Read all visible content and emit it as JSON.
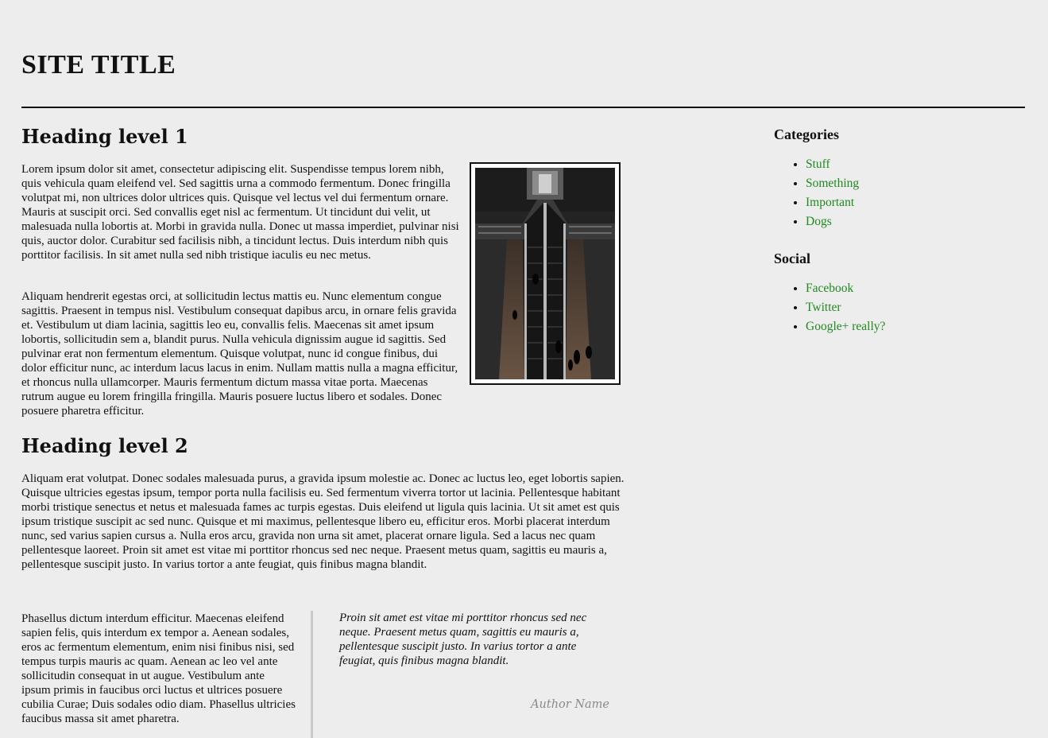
{
  "header": {
    "site_title": "SITE TITLE"
  },
  "main": {
    "heading1": "Heading level 1",
    "paragraph1": "Lorem ipsum dolor sit amet, consectetur adipiscing elit. Suspendisse tempus lorem nibh, quis vehicula quam eleifend vel. Sed sagittis urna a commodo fermentum. Donec fringilla volutpat mi, non ultrices dolor ultrices quis. Quisque vel lectus vel dui fermentum ornare. Mauris at suscipit orci. Sed convallis eget nisl ac fermentum. Ut tincidunt dui velit, ut malesuada nulla lobortis at. Morbi in gravida nulla. Donec ut massa imperdiet, pulvinar nisi quis, auctor dolor. Curabitur sed facilisis nibh, a tincidunt lectus. Duis interdum nibh quis porttitor facilisis. In sit amet nulla sed nibh tristique iaculis eu nec metus.",
    "paragraph2": "Aliquam hendrerit egestas orci, at sollicitudin lectus mattis eu. Nunc elementum congue sagittis. Praesent in tempus nisl. Vestibulum consequat dapibus arcu, in ornare felis gravida et. Vestibulum ut diam lacinia, sagittis leo eu, convallis felis. Maecenas sit amet ipsum lobortis, sollicitudin sem a, blandit purus. Nulla vehicula dignissim augue id sagittis. Sed pulvinar erat non fermentum elementum. Quisque volutpat, nunc id congue finibus, dui dolor efficitur nunc, ac interdum lacus lacus in enim. Nullam mattis nulla a magna efficitur, et rhoncus nulla ullamcorper. Mauris fermentum dictum massa vitae porta. Maecenas rutrum augue eu lorem fringilla fringilla. Mauris posuere luctus libero et sodales. Donec posuere pharetra efficitur.",
    "heading2": "Heading level 2",
    "paragraph3": "Aliquam erat volutpat. Donec sodales malesuada purus, a gravida ipsum molestie ac. Donec ac luctus leo, eget lobortis sapien. Quisque ultricies egestas ipsum, tempor porta nulla facilisis eu. Sed fermentum viverra tortor ut lacinia. Pellentesque habitant morbi tristique senectus et netus et malesuada fames ac turpis egestas. Duis eleifend ut ligula quis lacinia. Ut sit amet est quis ipsum tristique suscipit ac sed nunc. Quisque et mi maximus, pellentesque libero eu, efficitur eros. Morbi placerat interdum nunc, sed varius sapien cursus a. Nulla eros arcu, gravida non urna sit amet, placerat ornare ligula. Sed a lacus nec quam pellentesque laoreet. Proin sit amet est vitae mi porttitor rhoncus sed nec neque. Praesent metus quam, sagittis eu mauris a, pellentesque suscipit justo. In varius tortor a ante feugiat, quis finibus magna blandit.",
    "paragraph4": "Phasellus dictum interdum efficitur. Maecenas eleifend sapien felis, quis interdum ex tempor a. Aenean sodales, eros ac fermentum elementum, enim nisi finibus nisi, sed tempus turpis mauris ac quam. Aenean ac leo vel ante sollicitudin consequat in ut augue. Vestibulum ante ipsum primis in faucibus orci luctus et ultrices posuere cubilia Curae; Duis sodales odio diam. Phasellus ultricies faucibus massa sit amet pharetra.",
    "blockquote": {
      "text": "Proin sit amet est vitae mi porttitor rhoncus sed nec neque. Praesent metus quam, sagittis eu mauris a, pellentesque suscipit justo. In varius tortor a ante feugiat, quis finibus magna blandit.",
      "author": "Author Name"
    }
  },
  "sidebar": {
    "categories_heading": "Categories",
    "categories": [
      "Stuff",
      "Something",
      "Important",
      "Dogs"
    ],
    "social_heading": "Social",
    "social": [
      "Facebook",
      "Twitter",
      "Google+ really?"
    ]
  },
  "colors": {
    "background": "#ededed",
    "link": "#1f8a1f",
    "quote_text": "#8a8a8a",
    "quote_border": "#c9c9c9"
  }
}
